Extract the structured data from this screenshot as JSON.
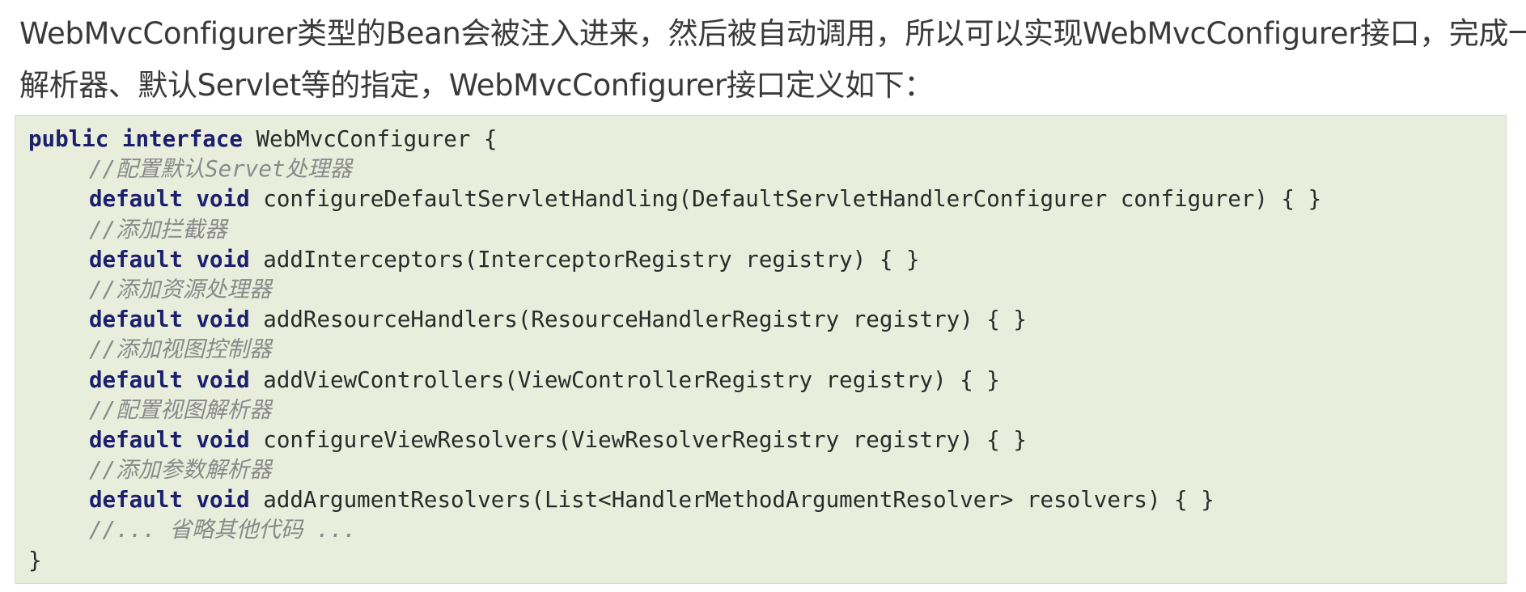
{
  "paragraph": {
    "line1": "WebMvcConfigurer类型的Bean会被注入进来，然后被自动调用，所以可以实现WebMvcConfigurer接口，完成一些",
    "line2": "解析器、默认Servlet等的指定，WebMvcConfigurer接口定义如下："
  },
  "code": {
    "decl_kw1": "public",
    "decl_kw2": "interface",
    "decl_rest": " WebMvcConfigurer {",
    "members": [
      {
        "comment": "//配置默认Servet处理器",
        "kw1": "default",
        "kw2": "void",
        "signature": " configureDefaultServletHandling(DefaultServletHandlerConfigurer configurer) { }"
      },
      {
        "comment": "//添加拦截器",
        "kw1": "default",
        "kw2": "void",
        "signature": " addInterceptors(InterceptorRegistry registry) { }"
      },
      {
        "comment": "//添加资源处理器",
        "kw1": "default",
        "kw2": "void",
        "signature": " addResourceHandlers(ResourceHandlerRegistry registry) { }"
      },
      {
        "comment": "//添加视图控制器",
        "kw1": "default",
        "kw2": "void",
        "signature": " addViewControllers(ViewControllerRegistry registry) { }"
      },
      {
        "comment": "//配置视图解析器",
        "kw1": "default",
        "kw2": "void",
        "signature": " configureViewResolvers(ViewResolverRegistry registry) { }"
      },
      {
        "comment": "//添加参数解析器",
        "kw1": "default",
        "kw2": "void",
        "signature": " addArgumentResolvers(List<HandlerMethodArgumentResolver> resolvers) { }"
      }
    ],
    "trailing_comment": "//... 省略其他代码 ...",
    "closing": "}"
  },
  "colors": {
    "keyword": "#1b1f6d",
    "comment": "#8a8a8a",
    "code_background": "#e9eddc",
    "text": "#3a3a3a"
  }
}
